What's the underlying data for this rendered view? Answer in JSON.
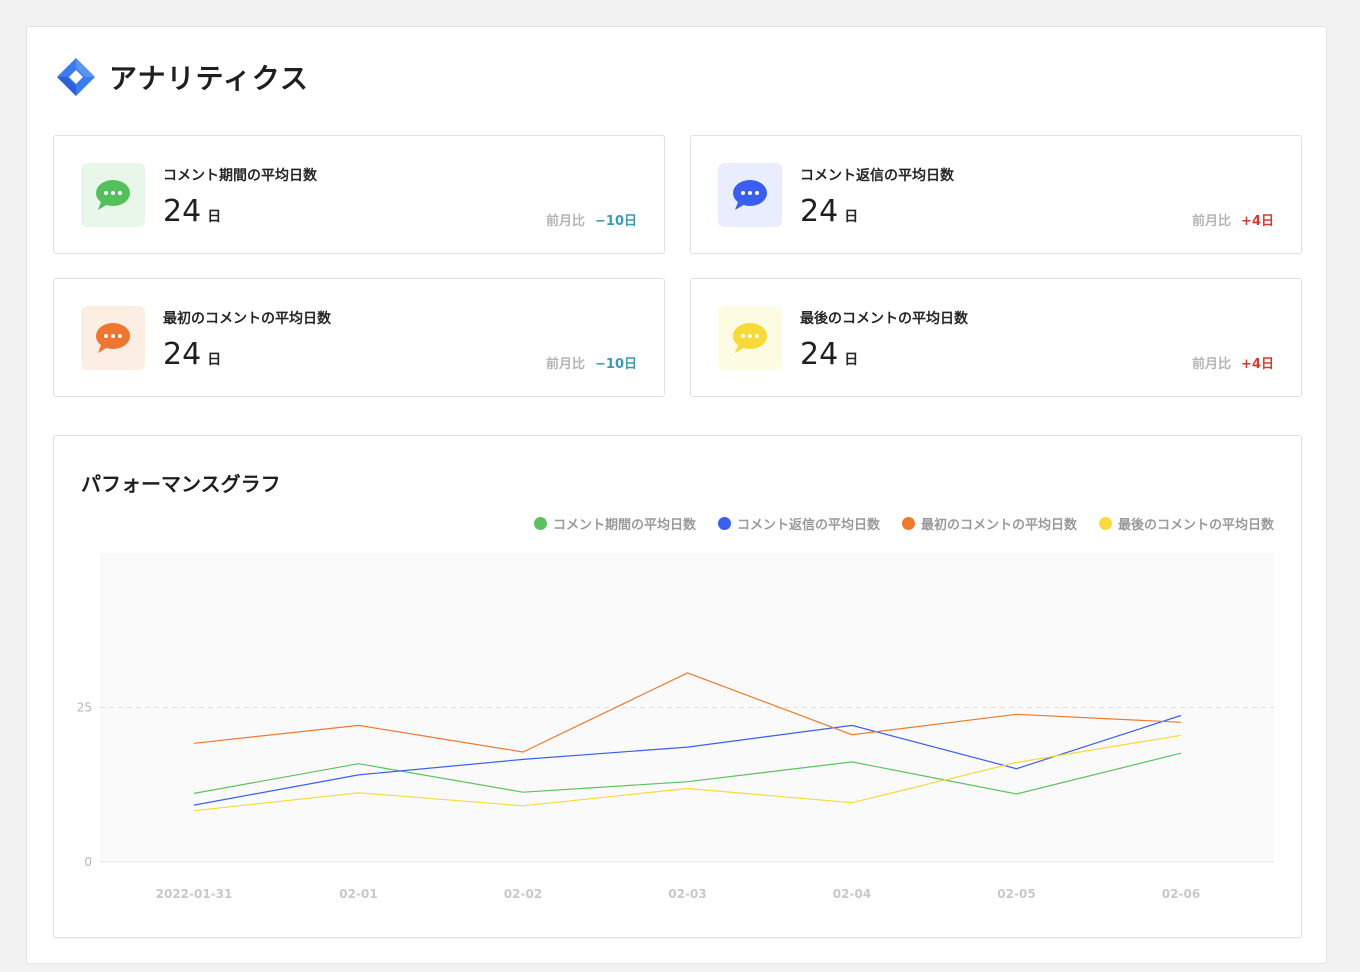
{
  "header": {
    "title": "アナリティクス",
    "logo_icon": "diamond-logo-icon",
    "logo_color": "#3b7bf0"
  },
  "cards": [
    {
      "label": "コメント期間の平均日数",
      "value": "24",
      "unit": "日",
      "compare_label": "前月比",
      "delta": "−10日",
      "delta_color": "#3a9bb0",
      "icon": "chat-bubble-icon",
      "icon_color": "#54c05c",
      "bg_color": "#e9f7ea"
    },
    {
      "label": "コメント返信の平均日数",
      "value": "24",
      "unit": "日",
      "compare_label": "前月比",
      "delta": "+4日",
      "delta_color": "#d63a2c",
      "icon": "chat-bubble-icon",
      "icon_color": "#3a5ff0",
      "bg_color": "#e9edfd"
    },
    {
      "label": "最初のコメントの平均日数",
      "value": "24",
      "unit": "日",
      "compare_label": "前月比",
      "delta": "−10日",
      "delta_color": "#3a9bb0",
      "icon": "chat-bubble-icon",
      "icon_color": "#ef7630",
      "bg_color": "#fdeee4"
    },
    {
      "label": "最後のコメントの平均日数",
      "value": "24",
      "unit": "日",
      "compare_label": "前月比",
      "delta": "+4日",
      "delta_color": "#d63a2c",
      "icon": "chat-bubble-icon",
      "icon_color": "#f8d93a",
      "bg_color": "#fefbe3"
    }
  ],
  "chart_section": {
    "title": "パフォーマンスグラフ"
  },
  "chart_data": {
    "type": "line",
    "x": [
      "2022-01-31",
      "02-01",
      "02-02",
      "02-03",
      "02-04",
      "02-05",
      "02-06"
    ],
    "ylim": [
      0,
      50
    ],
    "yticks": [
      0,
      25
    ],
    "grid": "dashed-y",
    "legend": "top-right",
    "series": [
      {
        "name": "コメント期間の平均日数",
        "color": "#5cc25f",
        "values": [
          11.1,
          15.9,
          11.3,
          13.0,
          16.2,
          11.0,
          17.6
        ]
      },
      {
        "name": "コメント返信の平均日数",
        "color": "#3a5ff0",
        "values": [
          9.2,
          14.1,
          16.6,
          18.6,
          22.1,
          15.1,
          23.7
        ]
      },
      {
        "name": "最初のコメントの平均日数",
        "color": "#ee7a30",
        "values": [
          19.2,
          22.1,
          17.8,
          30.6,
          20.6,
          23.9,
          22.6
        ]
      },
      {
        "name": "最後のコメントの平均日数",
        "color": "#f9d93c",
        "values": [
          8.3,
          11.2,
          9.1,
          11.9,
          9.6,
          16.1,
          20.5
        ]
      }
    ]
  }
}
